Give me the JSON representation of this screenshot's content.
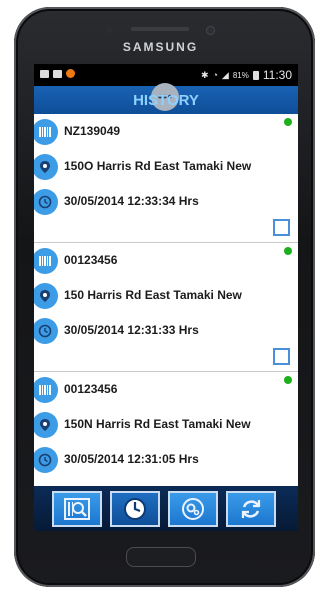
{
  "device": {
    "brand": "SAMSUNG"
  },
  "status_bar": {
    "battery": "81%",
    "time": "11:30",
    "menu_glyph": "•••"
  },
  "app": {
    "title": "HISTORY"
  },
  "history": [
    {
      "code": "NZ139049",
      "address": "150O Harris Rd East Tamaki New",
      "datetime": "30/05/2014 12:33:34 Hrs"
    },
    {
      "code": "00123456",
      "address": "150 Harris Rd East Tamaki New",
      "datetime": "30/05/2014 12:31:33 Hrs"
    },
    {
      "code": "00123456",
      "address": "150N Harris Rd East Tamaki New",
      "datetime": "30/05/2014 12:31:05 Hrs"
    }
  ],
  "colors": {
    "accent": "#1a62b4",
    "title_text": "#8ed0ff",
    "status_dot": "#1db01d",
    "icon_bg": "#3d9ce6"
  },
  "toolbar": {
    "buttons": [
      "scan-icon",
      "clock-icon",
      "settings-icon",
      "sync-icon"
    ],
    "active": "clock-icon"
  }
}
